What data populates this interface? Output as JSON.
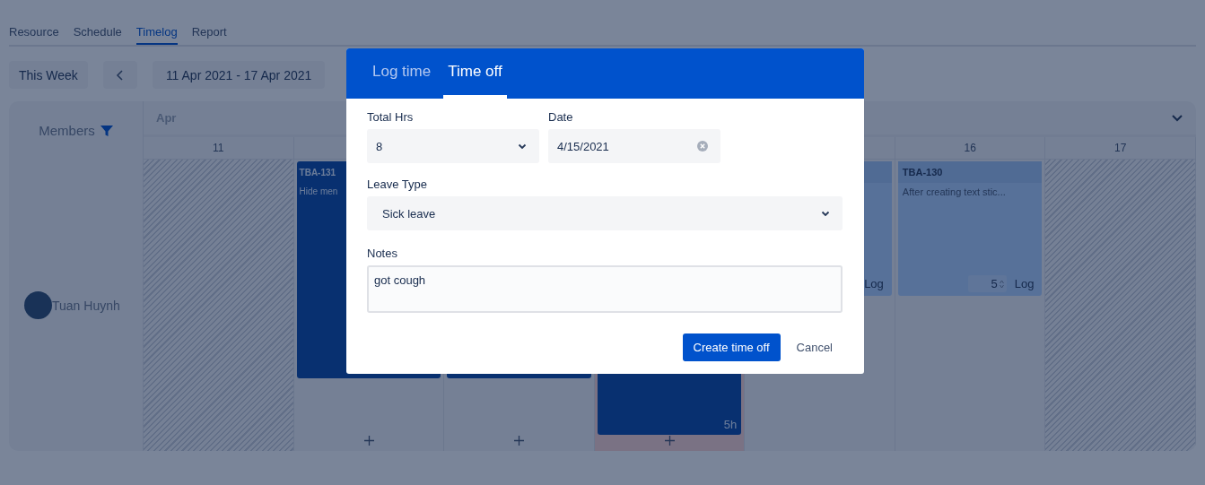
{
  "nav_tabs": [
    {
      "label": "Resource",
      "selected": false
    },
    {
      "label": "Schedule",
      "selected": false
    },
    {
      "label": "Timelog",
      "selected": true
    },
    {
      "label": "Report",
      "selected": false
    }
  ],
  "toolbar": {
    "this_week": "This Week",
    "date_range": "11 Apr 2021 - 17 Apr 2021"
  },
  "calendar": {
    "month": "Apr",
    "members_header": "Members",
    "member": {
      "name": "Tuan Huynh"
    },
    "days": [
      {
        "label": "11",
        "weekend": true,
        "today": false,
        "add": false
      },
      {
        "weekend": false,
        "today": false,
        "add": true,
        "cards": [
          {
            "kind": "logged",
            "key": "TBA-131",
            "summary": "Hide men"
          }
        ]
      },
      {
        "weekend": false,
        "today": false,
        "add": true,
        "cards": [
          {
            "kind": "logged"
          }
        ]
      },
      {
        "weekend": false,
        "today": true,
        "add": true,
        "cards": [
          {
            "kind": "logged",
            "hours": "5h"
          }
        ]
      },
      {
        "weekend": false,
        "today": false,
        "add": false,
        "cards": [
          {
            "kind": "task",
            "log_button": "Log"
          }
        ]
      },
      {
        "label": "16",
        "weekend": false,
        "today": false,
        "add": false,
        "cards": [
          {
            "kind": "task",
            "key": "TBA-130",
            "summary": "After creating text stic...",
            "log_value": "5",
            "log_button": "Log"
          }
        ]
      },
      {
        "label": "17",
        "weekend": true,
        "today": false,
        "add": false
      }
    ]
  },
  "dialog": {
    "tabs": [
      {
        "label": "Log time",
        "selected": false
      },
      {
        "label": "Time off",
        "selected": true
      }
    ],
    "total_hrs": {
      "label": "Total Hrs",
      "value": "8"
    },
    "date": {
      "label": "Date",
      "value": "4/15/2021"
    },
    "leave_type": {
      "label": "Leave Type",
      "value": "Sick leave"
    },
    "notes": {
      "label": "Notes",
      "value": "got cough"
    },
    "create_button": "Create time off",
    "cancel_button": "Cancel"
  }
}
